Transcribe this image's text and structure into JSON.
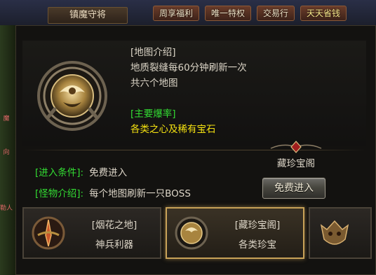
{
  "top_bar": {
    "title": "镇魔守将",
    "menu": [
      {
        "label": "周享福利",
        "hot": false
      },
      {
        "label": "唯一特权",
        "hot": false
      },
      {
        "label": "交易行",
        "hot": false
      },
      {
        "label": "天天省钱",
        "hot": true
      }
    ],
    "left_tags": [
      "魔",
      "向",
      "勒人"
    ]
  },
  "map_info": {
    "intro_heading": "[地图介绍]",
    "intro_line1": "地质裂缝每60分钟刷新一次",
    "intro_line2": "共六个地图",
    "drop_heading": "[主要爆率]",
    "drop_text": "各类之心及稀有宝石"
  },
  "conditions": {
    "entry_label": "[进入条件]:",
    "entry_value": "免费进入",
    "monster_label": "[怪物介绍]:",
    "monster_value": "每个地图刷新一只BOSS"
  },
  "treasure": {
    "title": "藏珍宝阁",
    "enter_button": "免费进入"
  },
  "cards": [
    {
      "name": "[烟花之地]",
      "desc": "神兵利器",
      "selected": false,
      "icon": "sword-medal-icon"
    },
    {
      "name": "[藏珍宝阁]",
      "desc": "各类珍宝",
      "selected": true,
      "icon": "treasure-medal-icon"
    },
    {
      "name": "",
      "desc": "",
      "selected": false,
      "icon": "demon-skull-icon"
    }
  ],
  "colors": {
    "green_label": "#33dd33",
    "yellow_text": "#f5e211",
    "selected_border": "#c8a258"
  }
}
